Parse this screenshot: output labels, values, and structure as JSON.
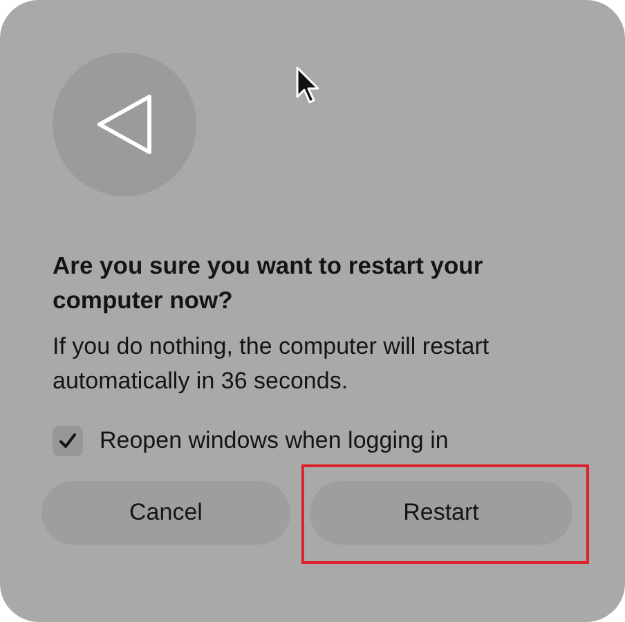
{
  "dialog": {
    "title": "Are you sure you want to restart your computer now?",
    "message": "If you do nothing, the computer will restart automatically in 36 seconds.",
    "checkbox": {
      "label": "Reopen windows when logging in",
      "checked": true
    },
    "buttons": [
      {
        "label": "Cancel",
        "highlighted": false
      },
      {
        "label": "Restart",
        "highlighted": true
      }
    ]
  }
}
